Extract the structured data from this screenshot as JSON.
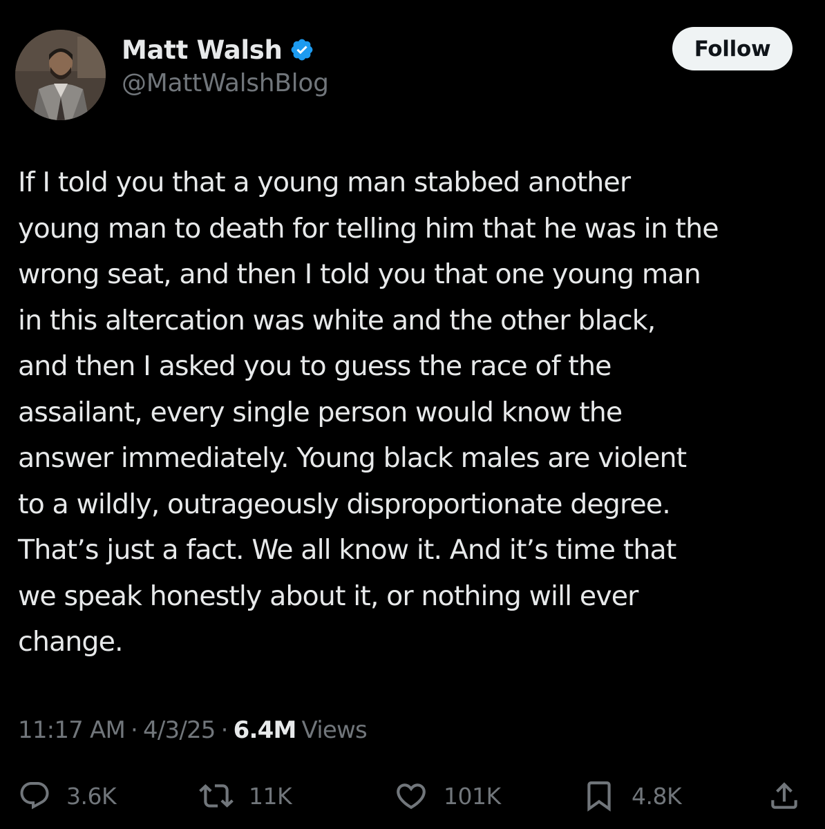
{
  "author": {
    "display_name": "Matt Walsh",
    "handle": "@MattWalshBlog",
    "verified": true,
    "verified_color": "#1d9bf0"
  },
  "follow_label": "Follow",
  "tweet": {
    "text": "If I told you that a young man stabbed another\nyoung man to death for telling him that he was in the\nwrong seat, and then I told you that one young man\nin this altercation was white and the other black,\nand then I asked you to guess the race of the\nassailant, every single person would know the\nanswer immediately. Young black males are violent\nto a wildly, outrageously disproportionate degree.\nThat’s just a fact. We all know it. And it’s time that\nwe speak honestly about it, or nothing will ever\nchange."
  },
  "meta": {
    "time": "11:17 AM",
    "separator": "·",
    "date": "4/3/25",
    "views_count": "6.4M",
    "views_label": "Views"
  },
  "actions": {
    "replies": "3.6K",
    "reposts": "11K",
    "likes": "101K",
    "bookmarks": "4.8K"
  },
  "icons": {
    "reply": "reply-icon",
    "repost": "repost-icon",
    "like": "heart-icon",
    "bookmark": "bookmark-icon",
    "share": "share-icon",
    "verified": "verified-badge-icon"
  },
  "colors": {
    "background": "#000000",
    "primary_text": "#e7e9ea",
    "secondary_text": "#71767b",
    "follow_button_bg": "#eff3f4",
    "follow_button_text": "#0f1419"
  }
}
